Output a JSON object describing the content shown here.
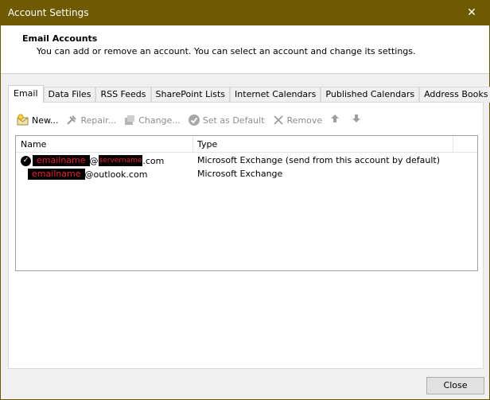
{
  "window": {
    "title": "Account Settings",
    "close_glyph": "✕"
  },
  "header": {
    "title": "Email Accounts",
    "description": "You can add or remove an account. You can select an account and change its settings."
  },
  "tabs": [
    {
      "label": "Email",
      "active": true
    },
    {
      "label": "Data Files"
    },
    {
      "label": "RSS Feeds"
    },
    {
      "label": "SharePoint Lists"
    },
    {
      "label": "Internet Calendars"
    },
    {
      "label": "Published Calendars"
    },
    {
      "label": "Address Books"
    }
  ],
  "toolbar": {
    "new_label": "New...",
    "repair_label": "Repair...",
    "change_label": "Change...",
    "set_default_label": "Set as Default",
    "remove_label": "Remove",
    "icons": {
      "new": "new-email-icon",
      "repair": "wrench-icon",
      "change": "change-icon",
      "set_default": "checkmark-circle-icon",
      "remove": "x-icon",
      "up": "arrow-up-icon",
      "down": "arrow-down-icon"
    }
  },
  "list": {
    "columns": {
      "name": "Name",
      "type": "Type"
    },
    "rows": [
      {
        "default": true,
        "name_redacted": "emailname",
        "at": "@",
        "server_redacted": "servername",
        "suffix": ".com",
        "type": "Microsoft Exchange (send from this account by default)"
      },
      {
        "default": false,
        "name_redacted": "emailname",
        "domain": "@outlook.com",
        "type": "Microsoft Exchange"
      }
    ]
  },
  "footer": {
    "close_label": "Close"
  }
}
